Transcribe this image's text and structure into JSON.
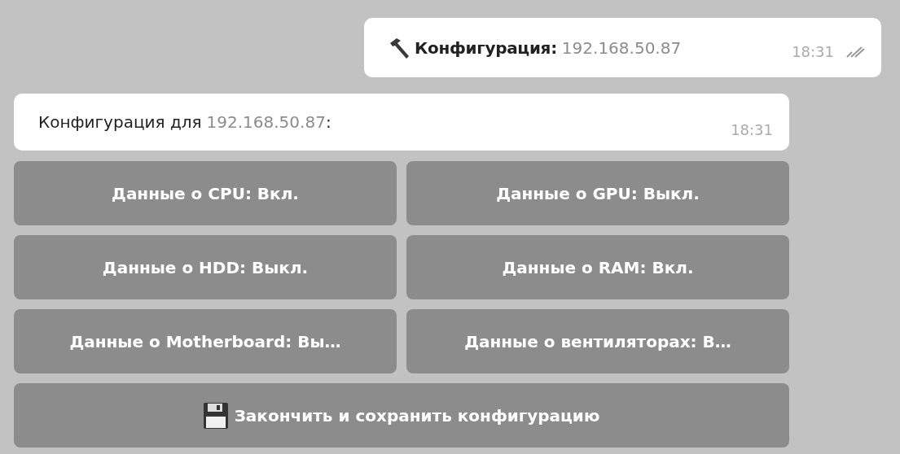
{
  "outgoing_message": {
    "label": "Конфигурация:",
    "ip": "192.168.50.87",
    "time": "18:31",
    "read": true
  },
  "incoming_message": {
    "label": "Конфигурация для",
    "ip": "192.168.50.87",
    "suffix": ":",
    "time": "18:31"
  },
  "keyboard": [
    {
      "label": "Данные о CPU: Вкл."
    },
    {
      "label": "Данные о GPU: Выкл."
    },
    {
      "label": "Данные о HDD: Выкл."
    },
    {
      "label": "Данные о RAM: Вкл."
    },
    {
      "label": "Данные о Motherboard: Вы…"
    },
    {
      "label": "Данные о вентиляторах: В…"
    },
    {
      "label": "Закончить и сохранить конфигурацию",
      "kind": "save"
    }
  ]
}
